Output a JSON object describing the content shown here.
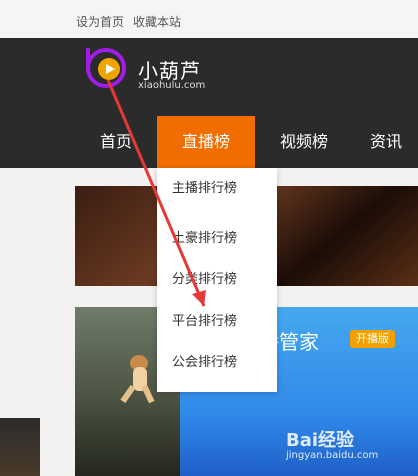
{
  "topbar": {
    "set_homepage": "设为首页",
    "bookmark": "收藏本站"
  },
  "logo": {
    "name": "小葫芦",
    "domain": "xiaohulu.com"
  },
  "nav": {
    "home": "首页",
    "live": "直播榜",
    "video": "视频榜",
    "news": "资讯"
  },
  "dropdown": {
    "items": [
      {
        "label": "主播排行榜"
      },
      {
        "label": "土豪排行榜"
      },
      {
        "label": "分类排行榜"
      },
      {
        "label": "平台排行榜"
      },
      {
        "label": "公会排行榜"
      }
    ]
  },
  "banner": {
    "title": "播管家",
    "badge": "开播版"
  },
  "watermark": {
    "main": "Bai经验",
    "sub": "jingyan.baidu.com"
  },
  "colors": {
    "header_bg": "#2b2b2b",
    "nav_active": "#f26d00",
    "logo_ring": "#a11ce8",
    "badge": "#f2a000",
    "arrow": "#e53935"
  }
}
